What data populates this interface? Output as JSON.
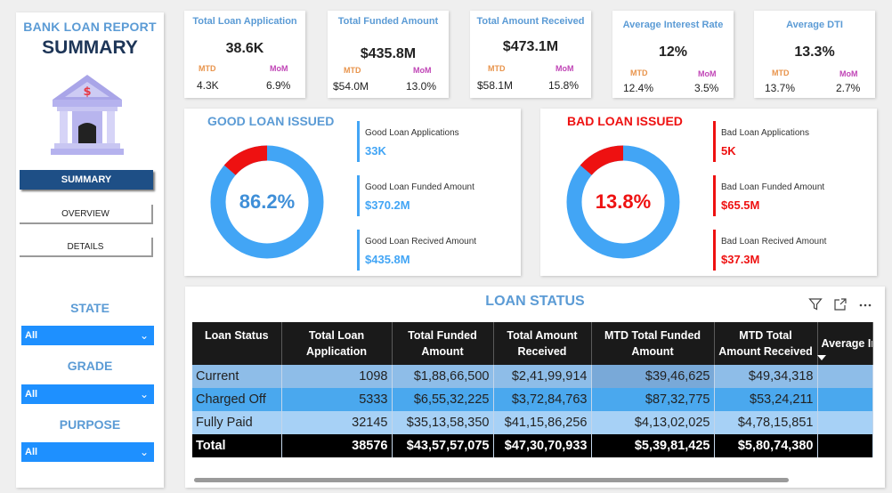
{
  "sidebar": {
    "title_small": "BANK LOAN REPORT",
    "title_big": "SUMMARY",
    "nav": [
      "SUMMARY",
      "OVERVIEW",
      "DETAILS"
    ],
    "filters": [
      {
        "label": "STATE",
        "value": "All"
      },
      {
        "label": "GRADE",
        "value": "All"
      },
      {
        "label": "PURPOSE",
        "value": "All"
      }
    ]
  },
  "kpis": [
    {
      "title": "Total Loan Application",
      "value": "38.6K",
      "mtd_label": "MTD",
      "mtd": "4.3K",
      "mom_label": "MoM",
      "mom": "6.9%"
    },
    {
      "title": "Total Funded Amount",
      "value": "$435.8M",
      "mtd_label": "MTD",
      "mtd": "$54.0M",
      "mom_label": "MoM",
      "mom": "13.0%"
    },
    {
      "title": "Total Amount Received",
      "value": "$473.1M",
      "mtd_label": "MTD",
      "mtd": "$58.1M",
      "mom_label": "MoM",
      "mom": "15.8%"
    },
    {
      "title": "Average Interest Rate",
      "value": "12%",
      "mtd_label": "MTD",
      "mtd": "12.4%",
      "mom_label": "MoM",
      "mom": "3.5%"
    },
    {
      "title": "Average DTI",
      "value": "13.3%",
      "mtd_label": "MTD",
      "mtd": "13.7%",
      "mom_label": "MoM",
      "mom": "2.7%"
    }
  ],
  "good_loan": {
    "title": "GOOD LOAN ISSUED",
    "percent_label": "86.2%",
    "percent": 86.2,
    "metrics": [
      {
        "label": "Good Loan Applications",
        "value": "33K"
      },
      {
        "label": "Good Loan Funded Amount",
        "value": "$370.2M"
      },
      {
        "label": "Good Loan Recived Amount",
        "value": "$435.8M"
      }
    ]
  },
  "bad_loan": {
    "title": "BAD LOAN ISSUED",
    "percent_label": "13.8%",
    "percent": 13.8,
    "metrics": [
      {
        "label": "Bad Loan Applications",
        "value": "5K"
      },
      {
        "label": "Bad Loan Funded Amount",
        "value": "$65.5M"
      },
      {
        "label": "Bad Loan Recived Amount",
        "value": "$37.3M"
      }
    ]
  },
  "colors": {
    "blue": "#42a5f5",
    "red": "#ee1111",
    "navy": "#1d3557",
    "accent": "#5b9bd5"
  },
  "loan_status": {
    "title": "LOAN STATUS",
    "columns": [
      "Loan Status",
      "Total Loan Application",
      "Total Funded Amount",
      "Total Amount Received",
      "MTD Total Funded Amount",
      "MTD Total Amount Received",
      "Average Interest"
    ],
    "rows": [
      [
        "Current",
        "1098",
        "$1,88,66,500",
        "$2,41,99,914",
        "$39,46,625",
        "$49,34,318",
        ""
      ],
      [
        "Charged Off",
        "5333",
        "$6,55,32,225",
        "$3,72,84,763",
        "$87,32,775",
        "$53,24,211",
        ""
      ],
      [
        "Fully Paid",
        "32145",
        "$35,13,58,350",
        "$41,15,86,256",
        "$4,13,02,025",
        "$4,78,15,851",
        ""
      ],
      [
        "Total",
        "38576",
        "$43,57,57,075",
        "$47,30,70,933",
        "$5,39,81,425",
        "$5,80,74,380",
        ""
      ]
    ]
  }
}
